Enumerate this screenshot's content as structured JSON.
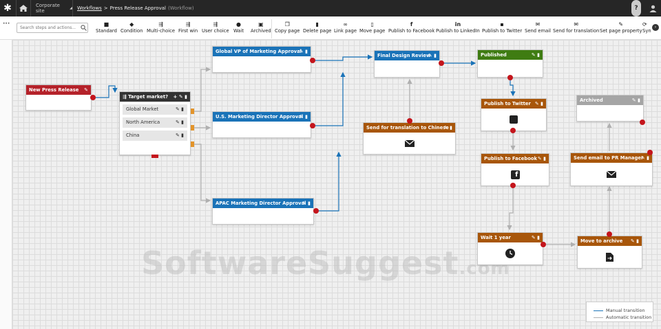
{
  "header": {
    "site": "Corporate site",
    "breadcrumb_link": "Workflows",
    "separator": ">",
    "page": "Press Release Approval",
    "page_type": "(Workflow)",
    "help": "?"
  },
  "toolbar": {
    "search_placeholder": "Search steps and actions...",
    "buttons": [
      {
        "label": "Standard",
        "icon": "square-icon"
      },
      {
        "label": "Condition",
        "icon": "diamond-icon"
      },
      {
        "label": "Multi-choice",
        "icon": "multi-choice-icon"
      },
      {
        "label": "First win",
        "icon": "first-win-icon"
      },
      {
        "label": "User choice",
        "icon": "user-choice-icon"
      },
      {
        "label": "Wait",
        "icon": "clock-icon"
      },
      {
        "label": "Archived",
        "icon": "archive-icon"
      },
      {
        "label": "Copy page",
        "icon": "copy-icon"
      },
      {
        "label": "Delete page",
        "icon": "trash-icon"
      },
      {
        "label": "Link page",
        "icon": "link-icon"
      },
      {
        "label": "Move page",
        "icon": "page-icon"
      },
      {
        "label": "Publish to Facebook",
        "icon": "facebook-icon"
      },
      {
        "label": "Publish to LinkedIn",
        "icon": "linkedin-icon"
      },
      {
        "label": "Publish to Twitter",
        "icon": "twitter-icon"
      },
      {
        "label": "Send email",
        "icon": "envelope-icon"
      },
      {
        "label": "Send for translation",
        "icon": "envelope-icon"
      },
      {
        "label": "Set page property",
        "icon": "pencil-icon"
      },
      {
        "label": "Syn",
        "icon": "sync-icon"
      }
    ]
  },
  "nodes": {
    "new_press_release": "New Press Release",
    "target_market": "Target market?",
    "global_market": "Global Market",
    "north_america": "North America",
    "china": "China",
    "global_vp": "Global VP of Marketing Approval",
    "us_director": "U.S. Marketing Director Approval",
    "apac_director": "APAC Marketing Director Approval",
    "final_review": "Final Design Review",
    "translation": "Send for translation to Chinese",
    "published": "Published",
    "publish_twitter": "Publish to Twitter",
    "publish_facebook": "Publish to Facebook",
    "wait": "Wait 1 year",
    "move_archive": "Move to archive",
    "archived": "Archived",
    "send_email_pr": "Send email to PR Manager"
  },
  "legend": {
    "manual": "Manual transition",
    "automatic": "Automatic transition",
    "manual_color": "#1a73b8",
    "automatic_color": "#b0b0b0"
  },
  "watermark": {
    "main": "SoftwareSuggest",
    "suffix": ".com"
  }
}
